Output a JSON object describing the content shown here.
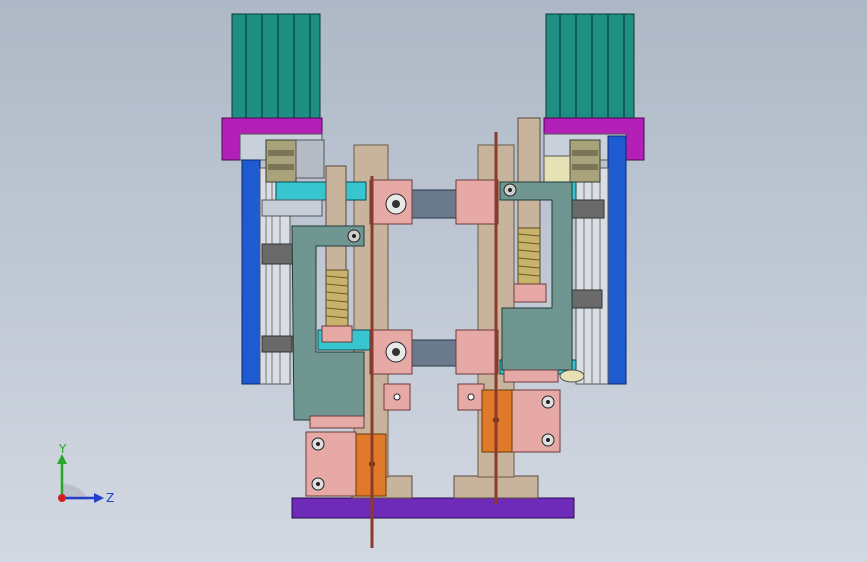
{
  "viewport": {
    "background_top": "#aeb8c6",
    "background_bottom": "#d3d9e2"
  },
  "model": {
    "name": "",
    "colors": {
      "motor_body": "#1f8f84",
      "motor_dark": "#0f5f58",
      "motor_flange": "#b320b8",
      "side_plate": "#1e5bd0",
      "rod": "#c8b49c",
      "slider": "#6f9690",
      "block": "#e6a9a6",
      "clamp": "#e07a2a",
      "base": "#6e2bb8",
      "arm": "#6a7a8c",
      "spring": "#c9b36a",
      "wire": "#8a3b2a",
      "cyan_plate": "#37c6d0"
    }
  },
  "triad": {
    "y_label": "Y",
    "z_label": "Z",
    "y_color": "#2aa52a",
    "z_color": "#2440c8",
    "x_color": "#d02020"
  }
}
